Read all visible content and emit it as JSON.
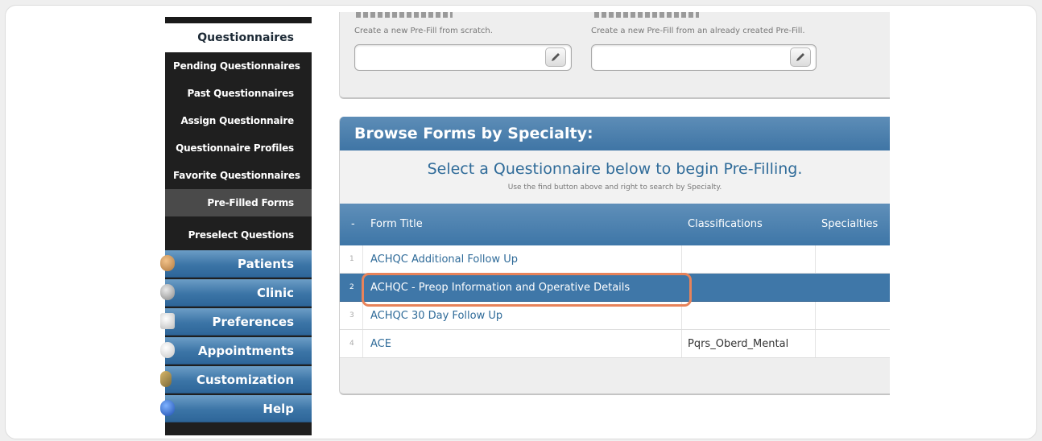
{
  "sidebar": {
    "header": "Questionnaires",
    "sub_items": [
      {
        "label": "Pending Questionnaires"
      },
      {
        "label": "Past Questionnaires"
      },
      {
        "label": "Assign Questionnaire"
      },
      {
        "label": "Questionnaire Profiles"
      },
      {
        "label": "Favorite Questionnaires"
      },
      {
        "label": "Pre-Filled Forms"
      },
      {
        "label": "Preselect Questions"
      }
    ],
    "main_items": [
      {
        "label": "Patients",
        "icon": "patients-icon"
      },
      {
        "label": "Clinic",
        "icon": "clinic-icon"
      },
      {
        "label": "Preferences",
        "icon": "preferences-icon"
      },
      {
        "label": "Appointments",
        "icon": "appointments-icon"
      },
      {
        "label": "Customization",
        "icon": "customization-icon"
      },
      {
        "label": "Help",
        "icon": "help-icon"
      }
    ]
  },
  "prefill": {
    "scratch_hint": "Create a new Pre-Fill from scratch.",
    "existing_hint": "Create a new Pre-Fill from an already created Pre-Fill."
  },
  "browse": {
    "title": "Browse Forms by Specialty:",
    "headline": "Select a Questionnaire below to begin Pre-Filling.",
    "subline": "Use the find button above and right to search by Specialty.",
    "columns": {
      "index": "-",
      "title": "Form Title",
      "classifications": "Classifications",
      "specialties": "Specialties"
    },
    "rows": [
      {
        "num": "1",
        "title": "ACHQC Additional Follow Up",
        "classifications": ""
      },
      {
        "num": "2",
        "title": "ACHQC - Preop Information and Operative Details",
        "classifications": ""
      },
      {
        "num": "3",
        "title": "ACHQC 30 Day Follow Up",
        "classifications": ""
      },
      {
        "num": "4",
        "title": "ACE",
        "classifications": "Pqrs_Oberd_Mental"
      }
    ]
  },
  "colors": {
    "accent": "#3f77a8",
    "highlight": "#e8835a"
  }
}
